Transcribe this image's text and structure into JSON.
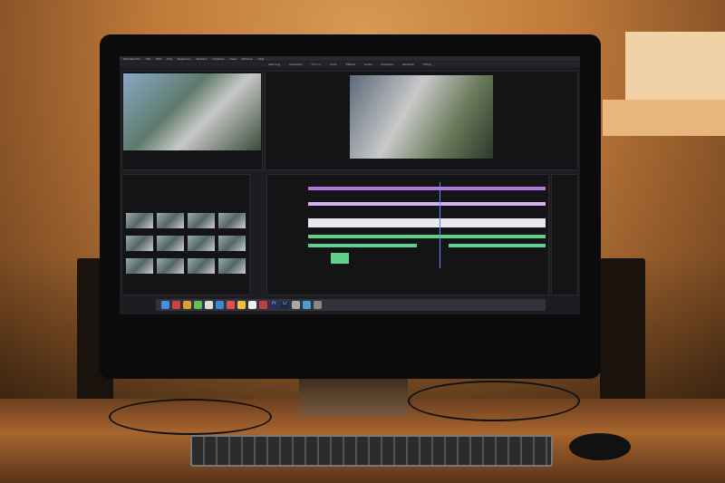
{
  "app": {
    "name": "Premiere Pro",
    "menu": [
      "Premiere Pro",
      "File",
      "Edit",
      "Clip",
      "Sequence",
      "Markers",
      "Graphics",
      "View",
      "Window",
      "Help"
    ],
    "workspaces": [
      "Learning",
      "Assembly",
      "Editing",
      "Color",
      "Effects",
      "Audio",
      "Graphics",
      "Libraries",
      "Titling"
    ],
    "active_workspace": "Editing",
    "dock_labels": [
      "Pr",
      "Lr"
    ]
  },
  "colors": {
    "wall": "#c07a3a",
    "screen": "#1d1d21",
    "timeline_video": "#b07ad8",
    "timeline_audio": "#5fd08a",
    "playhead": "#5a8cff"
  }
}
